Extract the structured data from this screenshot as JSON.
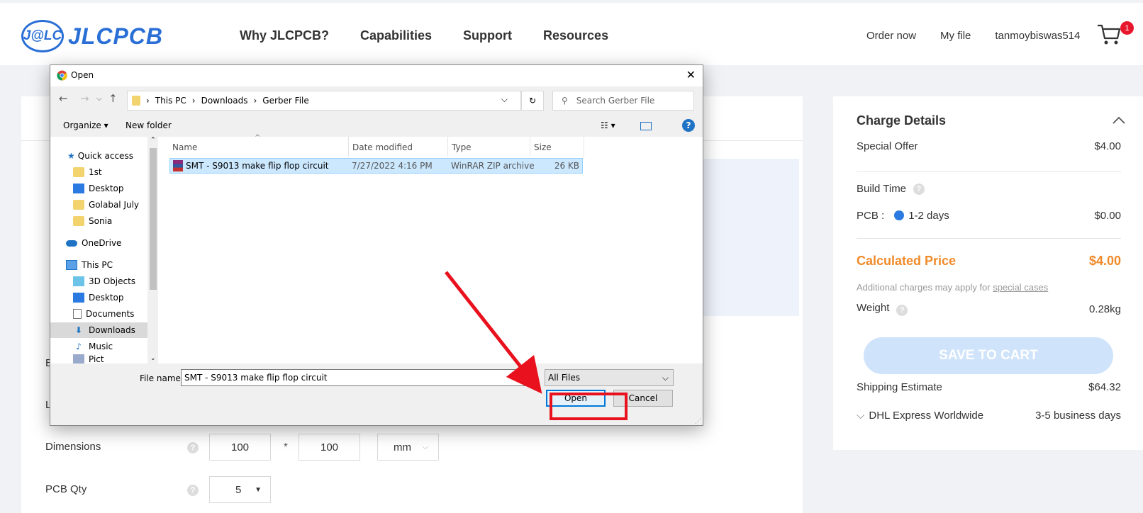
{
  "header": {
    "logo_badge": "J@LC",
    "logo_text": "JLCPCB",
    "nav": [
      "Why JLCPCB?",
      "Capabilities",
      "Support",
      "Resources"
    ],
    "order_now": "Order now",
    "my_file": "My file",
    "username": "tanmoybiswas514",
    "cart_count": "1"
  },
  "form": {
    "dimensions_label": "Dimensions",
    "dim_w": "100",
    "dim_h": "100",
    "dim_sep": "*",
    "dim_unit": "mm",
    "qty_label": "PCB Qty",
    "qty_value": "5",
    "partial_b": "B",
    "partial_l": "L"
  },
  "charge": {
    "title": "Charge Details",
    "special_offer_label": "Special Offer",
    "special_offer_value": "$4.00",
    "build_time_label": "Build Time",
    "pcb_label": "PCB :",
    "pcb_option": "1-2 days",
    "pcb_value": "$0.00",
    "calc_label": "Calculated Price",
    "calc_value": "$4.00",
    "note_prefix": "Additional charges may apply for ",
    "note_link": "special cases",
    "weight_label": "Weight",
    "weight_value": "0.28kg",
    "save_button": "SAVE TO CART",
    "shipping_label": "Shipping Estimate",
    "shipping_value": "$64.32",
    "carrier": "DHL Express Worldwide",
    "carrier_time": "3-5 business days"
  },
  "dialog": {
    "title": "Open",
    "breadcrumb": [
      "This PC",
      "Downloads",
      "Gerber File"
    ],
    "search_placeholder": "Search Gerber File",
    "organize": "Organize ▾",
    "new_folder": "New folder",
    "tree": [
      {
        "label": "Quick access",
        "icon": "star-icon"
      },
      {
        "label": "1st",
        "icon": "folder-icon"
      },
      {
        "label": "Desktop",
        "icon": "desktop-icon"
      },
      {
        "label": "Golabal July",
        "icon": "folder-icon"
      },
      {
        "label": "Sonia",
        "icon": "folder-icon"
      },
      {
        "label": "OneDrive",
        "icon": "cloud-icon"
      },
      {
        "label": "This PC",
        "icon": "pc-icon"
      },
      {
        "label": "3D Objects",
        "icon": "cube-icon"
      },
      {
        "label": "Desktop",
        "icon": "desktop-icon"
      },
      {
        "label": "Documents",
        "icon": "document-icon"
      },
      {
        "label": "Downloads",
        "icon": "download-icon"
      },
      {
        "label": "Music",
        "icon": "music-icon"
      },
      {
        "label": "Pict",
        "icon": "picture-icon"
      }
    ],
    "columns": [
      "Name",
      "Date modified",
      "Type",
      "Size"
    ],
    "file": {
      "name": "SMT - S9013 make flip flop circuit",
      "date": "7/27/2022 4:16 PM",
      "type": "WinRAR ZIP archive",
      "size": "26 KB"
    },
    "file_name_label": "File name:",
    "file_name_value": "SMT - S9013 make flip flop circuit",
    "file_type": "All Files",
    "open_button": "Open",
    "cancel_button": "Cancel"
  },
  "colors": {
    "brand_blue": "#2a6fd6",
    "price_orange": "#f08a2a",
    "highlight_red": "#e8111d",
    "selection_blue": "#cce8ff"
  }
}
